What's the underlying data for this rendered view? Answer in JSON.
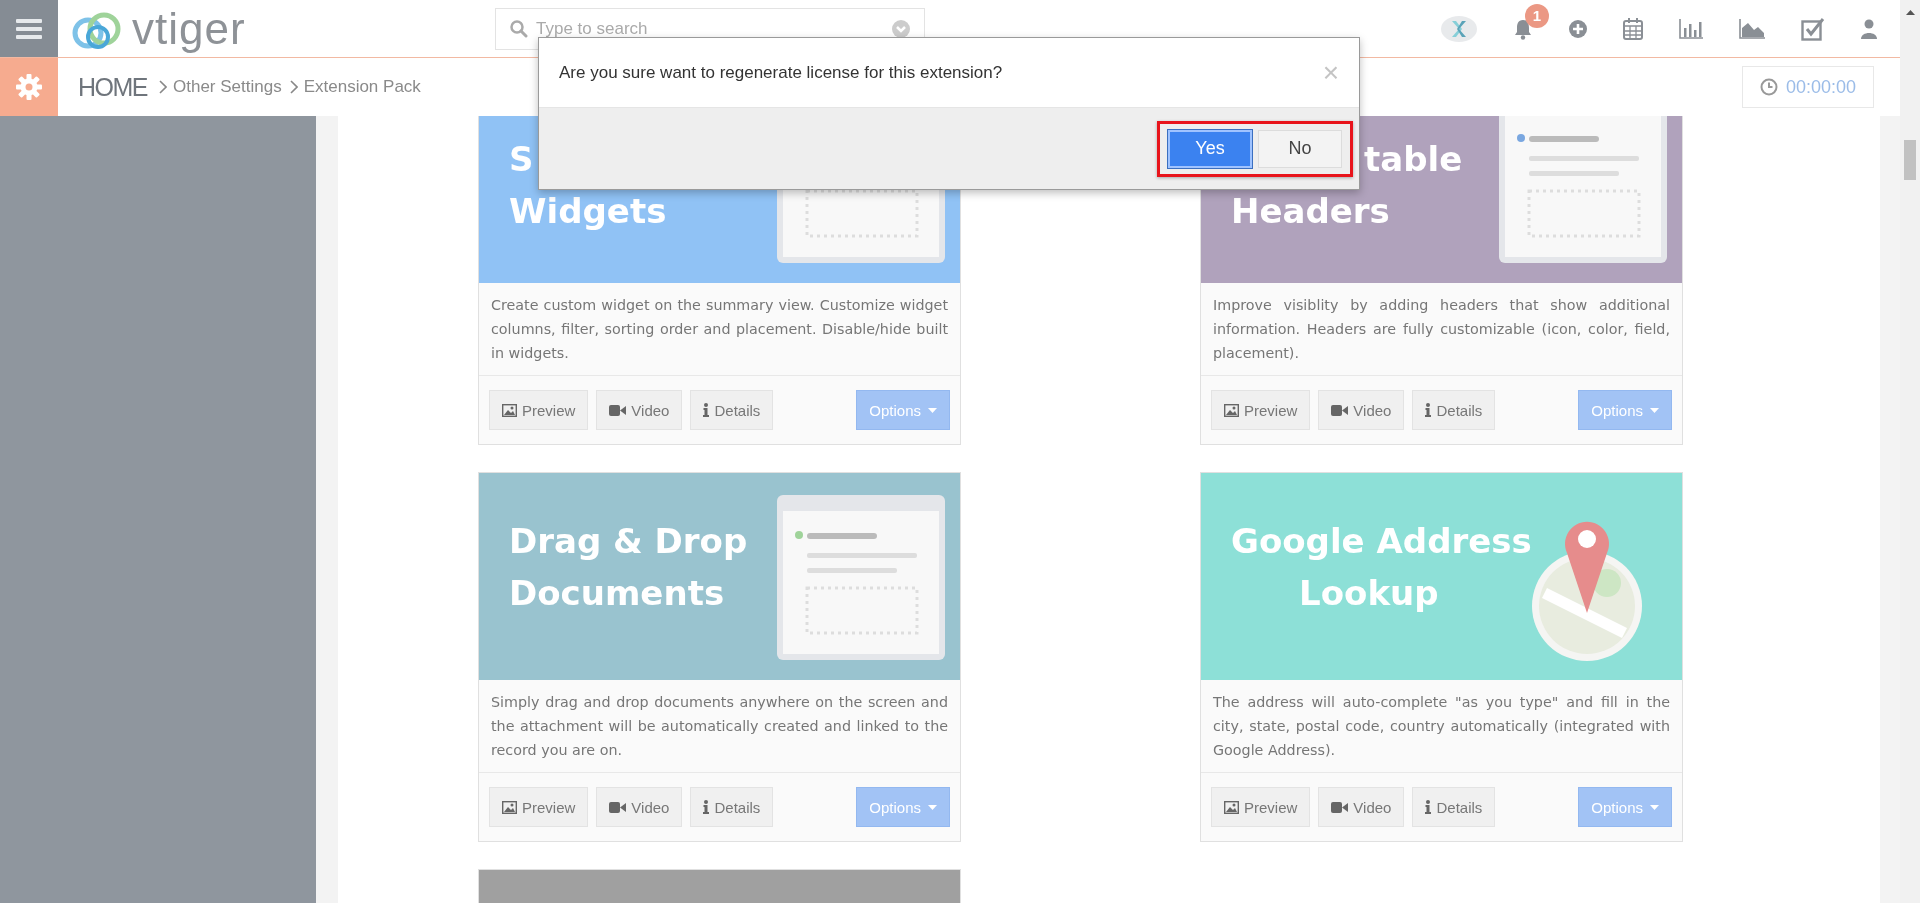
{
  "topbar": {
    "brand": "vtiger",
    "search": {
      "placeholder": "Type to search"
    },
    "notification_badge": "1"
  },
  "breadcrumb": [
    "HOME",
    "Other Settings",
    "Extension Pack"
  ],
  "timer": "00:00:00",
  "cards": [
    {
      "color": "#90c2f5",
      "title_lines": [
        "S",
        "Widgets"
      ],
      "description": "Create custom widget on the summary view. Customize widget columns, filter, sorting order and placement. Disable/hide built in widgets.",
      "buttons": [
        "Preview",
        "Video",
        "Details"
      ],
      "options": "Options"
    },
    {
      "color": "#b0a2bc",
      "title_lines": [
        "table",
        "Headers"
      ],
      "description": "Improve visiblity by adding headers that show additional information. Headers are fully customizable (icon, color, field, placement).",
      "buttons": [
        "Preview",
        "Video",
        "Details"
      ],
      "options": "Options"
    },
    {
      "color": "#99c3cf",
      "title_lines": [
        "Drag & Drop",
        "Documents"
      ],
      "description": "Simply drag and drop documents anywhere on the screen and the attachment will be automatically created and linked to the record you are on.",
      "buttons": [
        "Preview",
        "Video",
        "Details"
      ],
      "options": "Options"
    },
    {
      "color": "#8de0d7",
      "title_lines": [
        "Google Address",
        "Lookup"
      ],
      "description": "The address will auto-complete \"as you type\" and fill in the city, state, postal code, country automatically (integrated with Google Address).",
      "buttons": [
        "Preview",
        "Video",
        "Details"
      ],
      "options": "Options"
    },
    {
      "color": "#a0a0a0"
    }
  ],
  "dialog": {
    "message": "Are you sure want to regenerate license for this extension?",
    "close": "×",
    "buttons": [
      {
        "label": "Yes",
        "kind": "primary"
      },
      {
        "label": "No",
        "kind": "default"
      }
    ]
  }
}
